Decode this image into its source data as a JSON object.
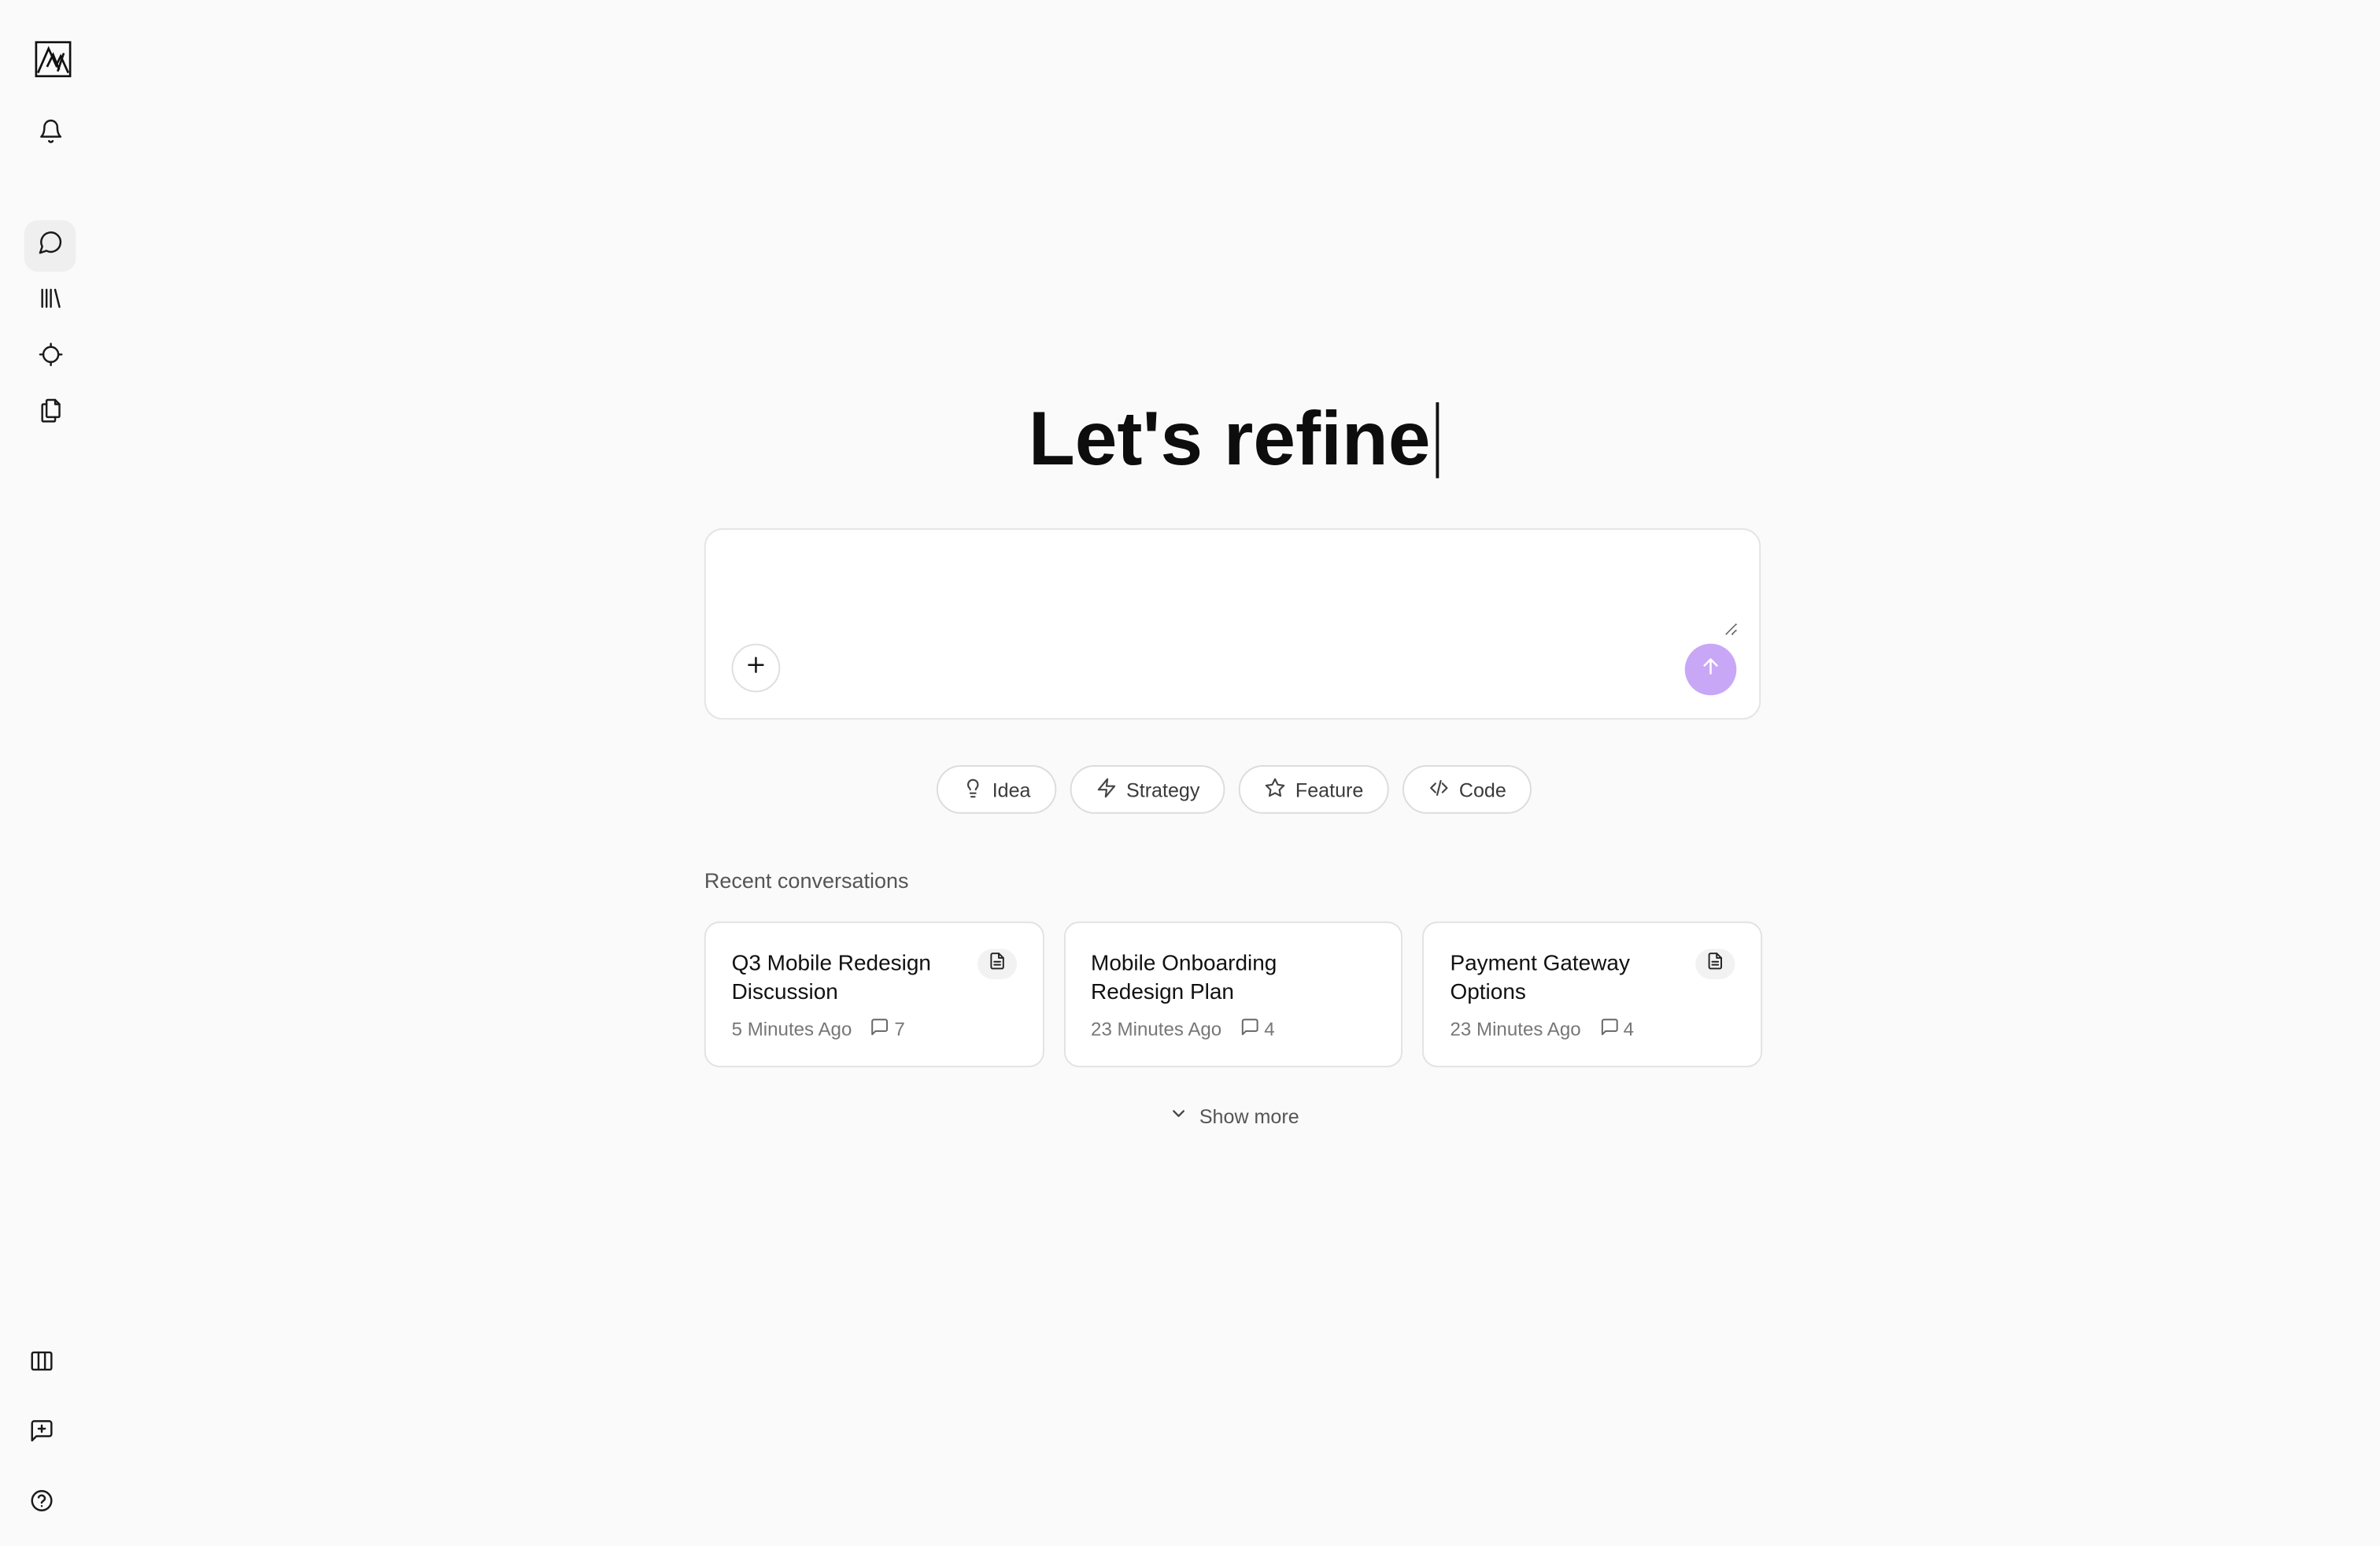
{
  "sidebar": {
    "logo": "app-logo",
    "top_icons": [
      "bell-icon"
    ],
    "nav_icons": [
      "chat-icon",
      "library-icon",
      "target-icon",
      "copy-icon"
    ],
    "bottom_icons": [
      "columns-icon",
      "feedback-icon",
      "help-icon"
    ]
  },
  "hero": {
    "title": "Let's refine"
  },
  "composer": {
    "placeholder": "",
    "value": "",
    "send_color": "#c9a7f7"
  },
  "chips": [
    {
      "label": "Idea",
      "icon": "lightbulb-icon"
    },
    {
      "label": "Strategy",
      "icon": "zap-icon"
    },
    {
      "label": "Feature",
      "icon": "star-icon"
    },
    {
      "label": "Code",
      "icon": "code-icon"
    }
  ],
  "recent": {
    "title": "Recent conversations",
    "cards": [
      {
        "title": "Q3 Mobile Redesign Discussion",
        "time": "5 Minutes Ago",
        "count": "7",
        "has_doc": true
      },
      {
        "title": "Mobile Onboarding Redesign Plan",
        "time": "23 Minutes Ago",
        "count": "4",
        "has_doc": false
      },
      {
        "title": "Payment Gateway Options",
        "time": "23 Minutes Ago",
        "count": "4",
        "has_doc": true
      }
    ],
    "show_more": "Show more"
  }
}
